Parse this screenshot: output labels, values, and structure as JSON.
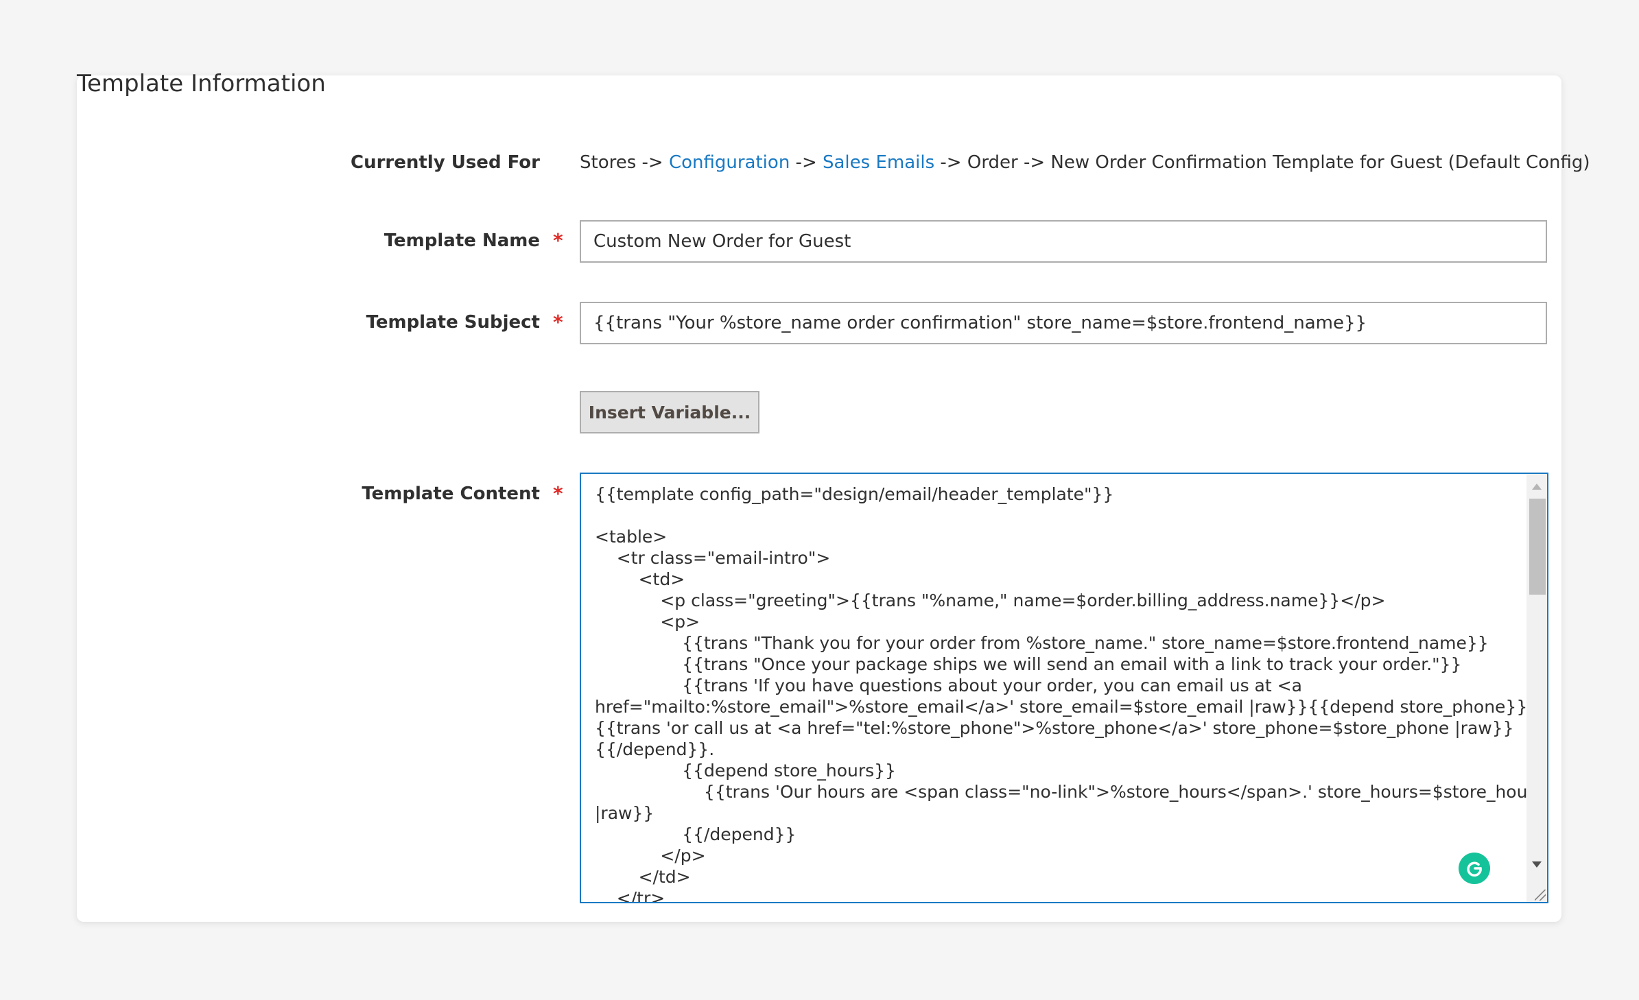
{
  "section": {
    "title": "Template Information"
  },
  "currently_used_for": {
    "label": "Currently Used For",
    "path": [
      {
        "text": "Stores",
        "link": false
      },
      {
        "text": " -> ",
        "link": false
      },
      {
        "text": "Configuration",
        "link": true
      },
      {
        "text": " -> ",
        "link": false
      },
      {
        "text": "Sales Emails",
        "link": true
      },
      {
        "text": " -> Order -> New Order Confirmation Template for Guest  (Default Config)",
        "link": false
      }
    ]
  },
  "template_name": {
    "label": "Template Name",
    "required": "*",
    "value": "Custom New Order for Guest"
  },
  "template_subject": {
    "label": "Template Subject",
    "required": "*",
    "value": "{{trans \"Your %store_name order confirmation\" store_name=$store.frontend_name}}"
  },
  "insert_variable": {
    "label": "Insert Variable..."
  },
  "template_content": {
    "label": "Template Content",
    "required": "*",
    "lines": [
      "{{template config_path=\"design/email/header_template\"}}",
      "",
      "<table>",
      "    <tr class=\"email-intro\">",
      "        <td>",
      "            <p class=\"greeting\">{{trans \"%name,\" name=$order.billing_address.name}}</p>",
      "            <p>",
      "                {{trans \"Thank you for your order from %store_name.\" store_name=$store.frontend_name}}",
      "                {{trans \"Once your package ships we will send an email with a link to track your order.\"}}",
      "                {{trans 'If you have questions about your order, you can email us at <a",
      "href=\"mailto:%store_email\">%store_email</a>' store_email=$store_email |raw}}{{depend store_phone}}",
      "{{trans 'or call us at <a href=\"tel:%store_phone\">%store_phone</a>' store_phone=$store_phone |raw}}",
      "{{/depend}}.",
      "                {{depend store_hours}}",
      "                    {{trans 'Our hours are <span class=\"no-link\">%store_hours</span>.' store_hours=$store_hours",
      "|raw}}",
      "                {{/depend}}",
      "            </p>",
      "        </td>",
      "    </tr>"
    ]
  },
  "icons": {
    "grammarly": "grammarly-icon",
    "scroll_up": "scroll-up-arrow-icon",
    "scroll_down": "scroll-down-arrow-icon",
    "resize": "resize-grip-icon"
  },
  "colors": {
    "link": "#1979c3",
    "required": "#e02b27",
    "focus_border": "#1979c3",
    "grammarly": "#15c39a"
  }
}
